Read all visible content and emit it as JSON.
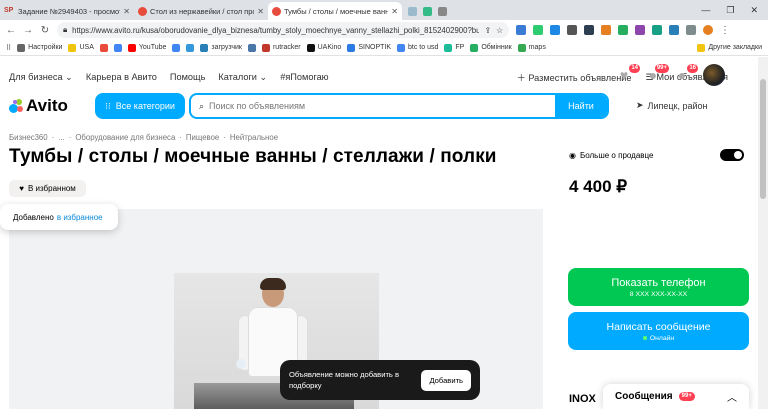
{
  "browser": {
    "tabs": [
      {
        "title": "Задание №2949403 - просмотр з",
        "favicon": "SP",
        "active": false
      },
      {
        "title": "Стол из нержавейки / стол произ",
        "favicon": "avito",
        "active": false
      },
      {
        "title": "Тумбы / столы / моечные ванны",
        "favicon": "avito",
        "active": true
      }
    ],
    "url": "https://www.avito.ru/kusa/oborudovanie_dlya_biznesa/tumby_stoly_moechnye_vanny_stellazhi_polki_8152402900?business...",
    "bookmarks": [
      "Настройки",
      "USA",
      "YouTube",
      "загрузчик",
      "rutracker",
      "UAKino",
      "SINOPTIK",
      "btc to usd",
      "FP",
      "Обмінник",
      "maps"
    ],
    "bookmarks_right": "Другие закладки"
  },
  "nav": {
    "links_left": [
      "Для бизнеса",
      "Карьера в Авито",
      "Помощь",
      "Каталоги",
      "#яПомогаю"
    ],
    "post_ad": "Разместить объявление",
    "my_ads": "Мои объявления",
    "badges": {
      "favorites": "14",
      "messages": "99+",
      "notifications": "16"
    }
  },
  "header": {
    "logo": "Avito",
    "categories_button": "Все категории",
    "search_placeholder": "Поиск по объявлениям",
    "search_button": "Найти",
    "location": "Липецк, район"
  },
  "breadcrumbs": [
    "Бизнес360",
    "...",
    "Оборудование для бизнеса",
    "Пищевое",
    "Нейтральное"
  ],
  "listing": {
    "title": "Тумбы / столы / моечные ванны / стеллажи / полки",
    "favorite_button": "В избранном",
    "added_prefix": "Добавлено",
    "added_link": "в избранное",
    "price": "4 400 ₽",
    "more_about_seller": "Больше о продавце",
    "show_phone": "Показать телефон",
    "phone_masked": "8 XXX XXX-XX-XX",
    "write_message": "Написать сообщение",
    "online": "Онлайн",
    "seller_name": "INOX",
    "toast_text": "Объявление можно добавить в подборку",
    "toast_button": "Добавить"
  },
  "messages_widget": {
    "label": "Сообщения",
    "count": "99+"
  },
  "colors": {
    "accent_blue": "#00aaff",
    "green": "#00c853",
    "badge_red": "#ff4053"
  }
}
